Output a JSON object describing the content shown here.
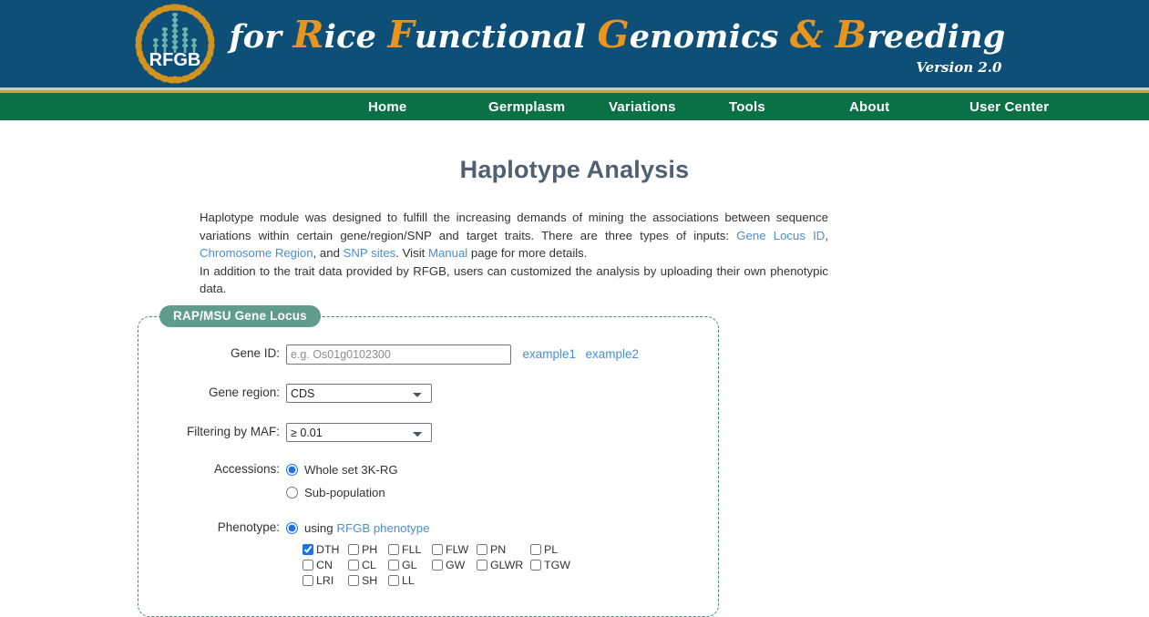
{
  "masthead": {
    "logo_text": "RFGB",
    "wordmark_parts": [
      {
        "t": "for ",
        "cap": false
      },
      {
        "t": "R",
        "cap": true
      },
      {
        "t": "ice ",
        "cap": false
      },
      {
        "t": "F",
        "cap": true
      },
      {
        "t": "unctional ",
        "cap": false
      },
      {
        "t": "G",
        "cap": true
      },
      {
        "t": "enomics ",
        "cap": false
      },
      {
        "t": "&",
        "cap": true
      },
      {
        "t": " ",
        "cap": false
      },
      {
        "t": "B",
        "cap": true
      },
      {
        "t": "reeding",
        "cap": false
      }
    ],
    "wordmark_plain": "for Rice Functional Genomics & Breeding",
    "version": "Version 2.0",
    "bg_color": "#0d4f77",
    "accent_color": "#e8941f"
  },
  "nav": {
    "items": [
      {
        "label": "Home"
      },
      {
        "label": "Germplasm"
      },
      {
        "label": "Variations"
      },
      {
        "label": "Tools"
      },
      {
        "label": "About"
      },
      {
        "label": "User Center"
      }
    ],
    "bg_color": "#0a7045",
    "rule_color": "#d8a01b"
  },
  "page": {
    "title": "Haplotype Analysis",
    "title_color": "#4e6071"
  },
  "intro": {
    "p1_a": "Haplotype module was designed to fulfill the increasing demands of mining the associations between sequence variations within certain gene/region/SNP and target traits. There are three types of inputs: ",
    "link_gene_locus": "Gene Locus ID",
    "p1_b": ", ",
    "link_chromosome_region": "Chromosome Region",
    "p1_c": ", and ",
    "link_snp_sites": "SNP sites",
    "p1_d": ". Visit ",
    "link_manual": "Manual",
    "p1_e": " page for more details.",
    "p2": "In addition to the trait data provided by RFGB, users can customized the analysis by uploading their own phenotypic data.",
    "link_color": "#4a8fd4"
  },
  "form": {
    "legend": "RAP/MSU Gene Locus",
    "legend_bg": "#5f9c8c",
    "border_color": "#3f8a78",
    "gene_id": {
      "label": "Gene ID:",
      "value": "",
      "placeholder": "e.g. Os01g0102300",
      "example1": "example1",
      "example2": "example2"
    },
    "gene_region": {
      "label": "Gene region:",
      "selected": "CDS",
      "options": [
        "CDS"
      ]
    },
    "maf": {
      "label": "Filtering by MAF:",
      "selected": "≥ 0.01",
      "options": [
        "≥ 0.01"
      ]
    },
    "accessions": {
      "label": "Accessions:",
      "options": [
        {
          "label": "Whole set 3K-RG",
          "checked": true
        },
        {
          "label": "Sub-population",
          "checked": false
        }
      ]
    },
    "phenotype": {
      "label": "Phenotype:",
      "radio_prefix": "using",
      "radio_link": "RFGB phenotype",
      "radio_checked": true,
      "traits": [
        [
          {
            "code": "DTH",
            "checked": true
          },
          {
            "code": "PH",
            "checked": false
          },
          {
            "code": "FLL",
            "checked": false
          },
          {
            "code": "FLW",
            "checked": false
          },
          {
            "code": "PN",
            "checked": false
          },
          {
            "code": "PL",
            "checked": false
          }
        ],
        [
          {
            "code": "CN",
            "checked": false
          },
          {
            "code": "CL",
            "checked": false
          },
          {
            "code": "GL",
            "checked": false
          },
          {
            "code": "GW",
            "checked": false
          },
          {
            "code": "GLWR",
            "checked": false
          },
          {
            "code": "TGW",
            "checked": false
          }
        ],
        [
          {
            "code": "LRI",
            "checked": false
          },
          {
            "code": "SH",
            "checked": false
          },
          {
            "code": "LL",
            "checked": false
          }
        ]
      ]
    }
  }
}
